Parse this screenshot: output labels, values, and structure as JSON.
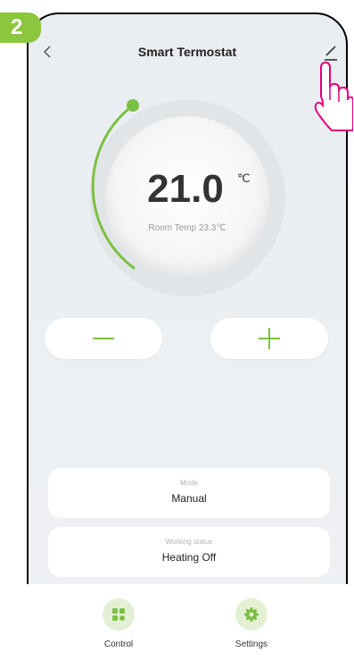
{
  "step": {
    "number": "2",
    "color": "#8cc63f"
  },
  "header": {
    "title": "Smart Termostat",
    "back_icon": "chevron-left-icon",
    "edit_icon": "pencil-icon"
  },
  "thermostat": {
    "set_temp": "21.0",
    "unit": "℃",
    "room_label": "Room Temp 23.3℃",
    "accent_color": "#7cc043"
  },
  "controls": {
    "minus_icon": "minus-icon",
    "plus_icon": "plus-icon"
  },
  "mode": {
    "label": "Mode",
    "value": "Manual"
  },
  "working_status": {
    "label": "Working status",
    "value": "Heating Off"
  },
  "tabs": [
    {
      "label": "Control",
      "icon": "grid-icon"
    },
    {
      "label": "Settings",
      "icon": "gear-icon"
    }
  ]
}
